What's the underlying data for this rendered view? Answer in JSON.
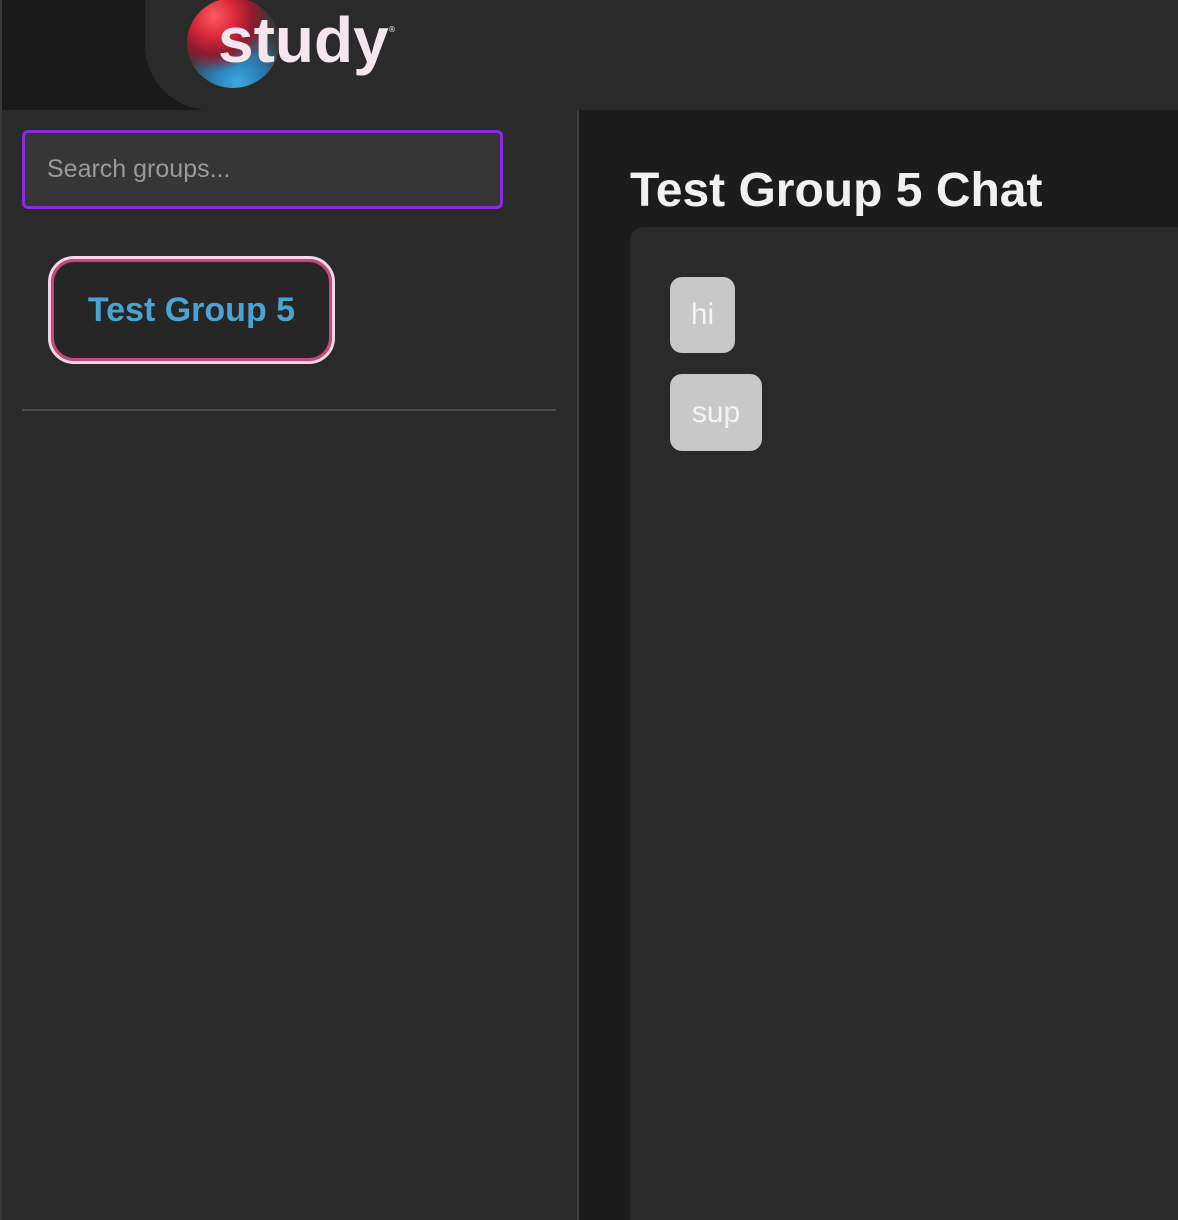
{
  "app": {
    "logo_text": "study",
    "logo_mark": "®"
  },
  "sidebar": {
    "search": {
      "placeholder": "Search groups...",
      "value": ""
    },
    "groups": [
      {
        "label": "Test Group 5",
        "selected": true
      }
    ]
  },
  "chat": {
    "title": "Test Group 5 Chat",
    "messages": [
      {
        "text": "hi"
      },
      {
        "text": "sup"
      }
    ]
  },
  "colors": {
    "search_border": "#8a2be2",
    "group_label": "#4aa3d1",
    "group_border_outer": "#f5d7e6",
    "group_border_inner": "#c9457a",
    "bubble_bg": "#c8c8c8"
  },
  "icons": {
    "logo": "study-logo-orb-icon"
  }
}
